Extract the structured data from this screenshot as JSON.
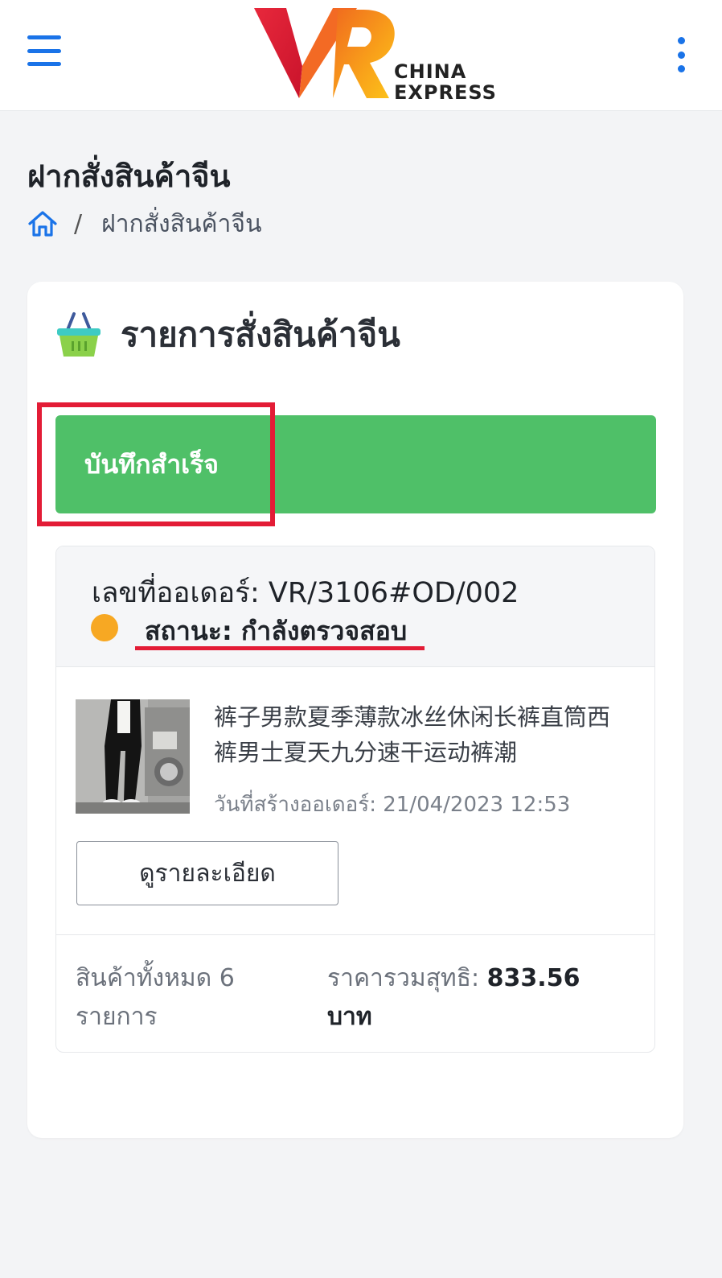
{
  "header": {
    "logo_line1": "CHINA",
    "logo_line2": "EXPRESS",
    "icons": [
      "hamburger-menu-icon",
      "more-vertical-icon"
    ],
    "accent": "#1a73e8"
  },
  "page": {
    "title": "ฝากสั่งสินค้าจีน",
    "breadcrumb_current": "ฝากสั่งสินค้าจีน",
    "breadcrumb_separator": "/"
  },
  "card": {
    "title": "รายการสั่งสินค้าจีน",
    "alert_text": "บันทึกสำเร็จ",
    "alert_color": "#4fc068"
  },
  "order": {
    "number": "เลขที่ออเดอร์: VR/3106#OD/002",
    "status": "สถานะ: กำลังตรวจสอบ",
    "status_color": "#f7a823",
    "product_name": "裤子男款夏季薄款冰丝休闲长裤直筒西裤男士夏天九分速干运动裤潮",
    "created": "วันที่สร้างออเดอร์: 21/04/2023 12:53",
    "detail_button": "ดูรายละเอียด",
    "total_items": "สินค้าทั้งหมด 6 รายการ",
    "net_price_label": "ราคารวมสุทธิ:",
    "net_price_value": "833.56",
    "currency": "บาท"
  },
  "annotation_color": "#e31c36"
}
